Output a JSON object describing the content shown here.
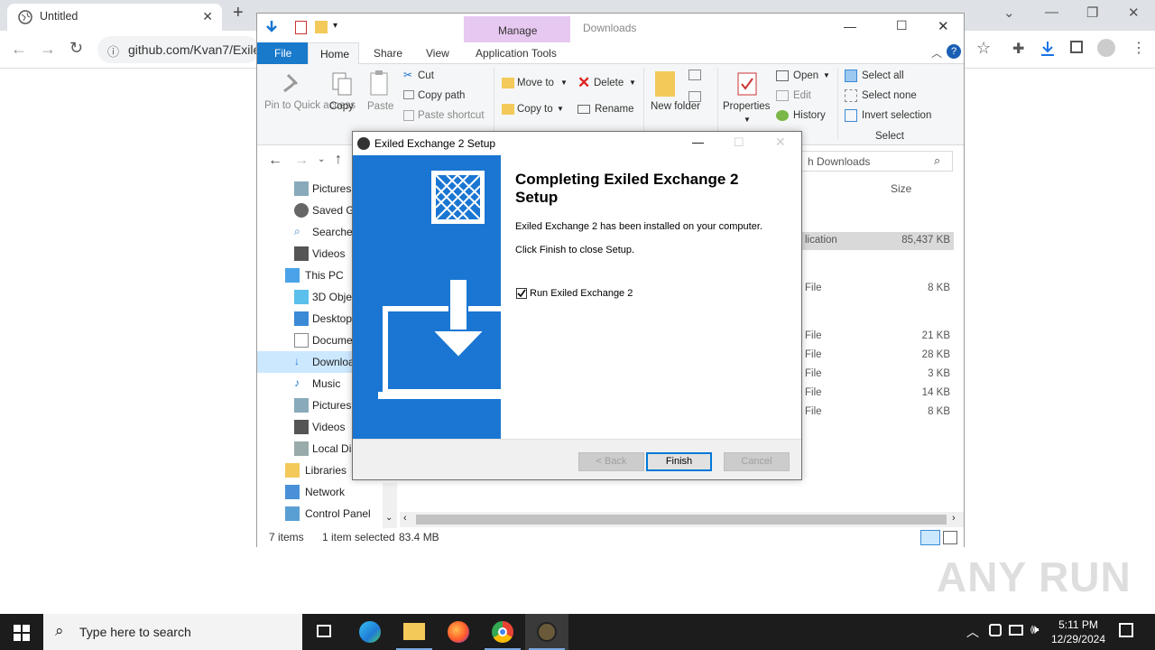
{
  "browser": {
    "tab_title": "Untitled",
    "address": "github.com/Kvan7/Exile"
  },
  "explorer": {
    "window_title": "Downloads",
    "context_tab": "Manage",
    "tabs": {
      "file": "File",
      "home": "Home",
      "share": "Share",
      "view": "View",
      "app_tools": "Application Tools"
    },
    "ribbon": {
      "pin": "Pin to Quick access",
      "copy": "Copy",
      "paste": "Paste",
      "cut": "Cut",
      "copy_path": "Copy path",
      "paste_shortcut": "Paste shortcut",
      "move_to": "Move to",
      "copy_to": "Copy to",
      "delete": "Delete",
      "rename": "Rename",
      "new_folder": "New folder",
      "properties": "Properties",
      "open": "Open",
      "edit": "Edit",
      "history": "History",
      "select_all": "Select all",
      "select_none": "Select none",
      "invert_selection": "Invert selection",
      "select_group": "Select"
    },
    "search_placeholder": "Search Downloads",
    "search_visible": "h Downloads",
    "column_size": "Size",
    "nav": [
      "Pictures",
      "Saved Ga",
      "Searches",
      "Videos",
      "This PC",
      "3D Objec",
      "Desktop",
      "Docume",
      "Downloa",
      "Music",
      "Pictures",
      "Videos",
      "Local Dis",
      "Libraries",
      "Network",
      "Control Panel"
    ],
    "files": [
      {
        "type": "lication",
        "size": "85,437 KB"
      },
      {
        "type": "File",
        "size": "8 KB"
      },
      {
        "type": "File",
        "size": "21 KB"
      },
      {
        "type": "File",
        "size": "28 KB"
      },
      {
        "type": "File",
        "size": "3 KB"
      },
      {
        "type": "File",
        "size": "14 KB"
      },
      {
        "type": "File",
        "size": "8 KB"
      }
    ],
    "status": {
      "items": "7 items",
      "selected": "1 item selected",
      "size": "83.4 MB"
    }
  },
  "dialog": {
    "title": "Exiled Exchange 2 Setup",
    "heading": "Completing Exiled Exchange 2 Setup",
    "line1": "Exiled Exchange 2 has been installed on your computer.",
    "line2": "Click Finish to close Setup.",
    "checkbox_label": "Run Exiled Exchange 2",
    "checkbox_checked": true,
    "back": "< Back",
    "finish": "Finish",
    "cancel": "Cancel"
  },
  "taskbar": {
    "search_placeholder": "Type here to search",
    "time": "5:11 PM",
    "date": "12/29/2024"
  },
  "watermark": "ANY RUN",
  "colors": {
    "accent": "#1a76d2",
    "file_tab": "#1979ca",
    "manage": "#e7c8f0"
  }
}
